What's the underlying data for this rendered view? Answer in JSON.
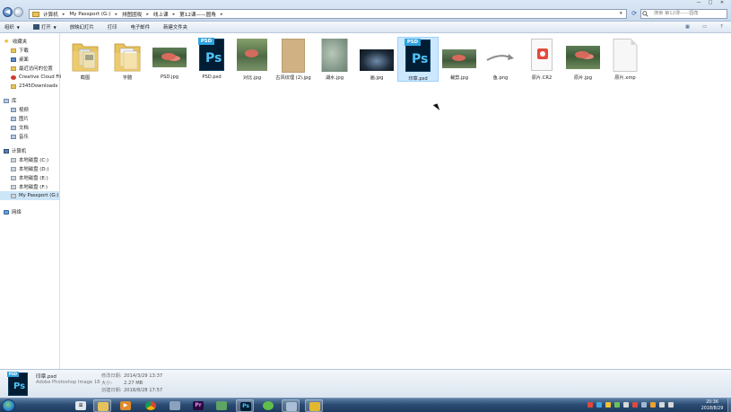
{
  "address_bar": {
    "crumbs": [
      "计算机",
      "My Passport (G:)",
      "排图囲咙",
      "线上课",
      "第12课——圆角"
    ],
    "search_placeholder": "搜索 第12课——圆角"
  },
  "window_buttons": {
    "minimize": "—",
    "maximize": "□",
    "close": "✕"
  },
  "toolbar": {
    "organize": "组织",
    "open": "打开",
    "slideshow": "放映幻灯片",
    "print": "打印",
    "email": "电子邮件",
    "new_folder": "新建文件夹"
  },
  "sidebar": {
    "favorites_header": "收藏夹",
    "favorites": [
      "下载",
      "桌面",
      "最近访问的位置",
      "Creative Cloud Files",
      "2345Downloads"
    ],
    "libraries_header": "库",
    "libraries": [
      "视频",
      "图片",
      "文档",
      "音乐"
    ],
    "computer_header": "计算机",
    "drives": [
      "本地磁盘 (C:)",
      "本地磁盘 (D:)",
      "本地磁盘 (E:)",
      "本地磁盘 (F:)",
      "My Passport (G:)"
    ],
    "network_header": "网络"
  },
  "files": [
    {
      "name": "截图",
      "type": "folder"
    },
    {
      "name": "字體",
      "type": "folder"
    },
    {
      "name": "PSD.jpg",
      "type": "jpg"
    },
    {
      "name": "PSD.psd",
      "type": "psd"
    },
    {
      "name": "对比.jpg",
      "type": "jpg"
    },
    {
      "name": "古风纹理 (2).jpg",
      "type": "jpg"
    },
    {
      "name": "湖水.jpg",
      "type": "jpg"
    },
    {
      "name": "画.jpg",
      "type": "jpg"
    },
    {
      "name": "印章.psd",
      "type": "psd",
      "selected": true
    },
    {
      "name": "裁剪.jpg",
      "type": "jpg"
    },
    {
      "name": "鱼.png",
      "type": "png"
    },
    {
      "name": "原片.CR2",
      "type": "cr2"
    },
    {
      "name": "原片.jpg",
      "type": "jpg"
    },
    {
      "name": "原片.xmp",
      "type": "xmp"
    }
  ],
  "details": {
    "name": "印章.psd",
    "type": "Adobe Photoshop Image 18",
    "modified_label": "修改日期:",
    "modified": "2014/3/29 13:37",
    "size_label": "大小:",
    "size": "2.27 MB",
    "created_label": "创建日期:",
    "created": "2018/8/28 17:57"
  },
  "taskbar": {
    "time": "20:36",
    "date": "2018/8/29"
  },
  "colors": {
    "selection": "#cce8ff",
    "selection_border": "#99d1ff",
    "ps_blue": "#2fa3e0",
    "ps_dark": "#001d34"
  }
}
